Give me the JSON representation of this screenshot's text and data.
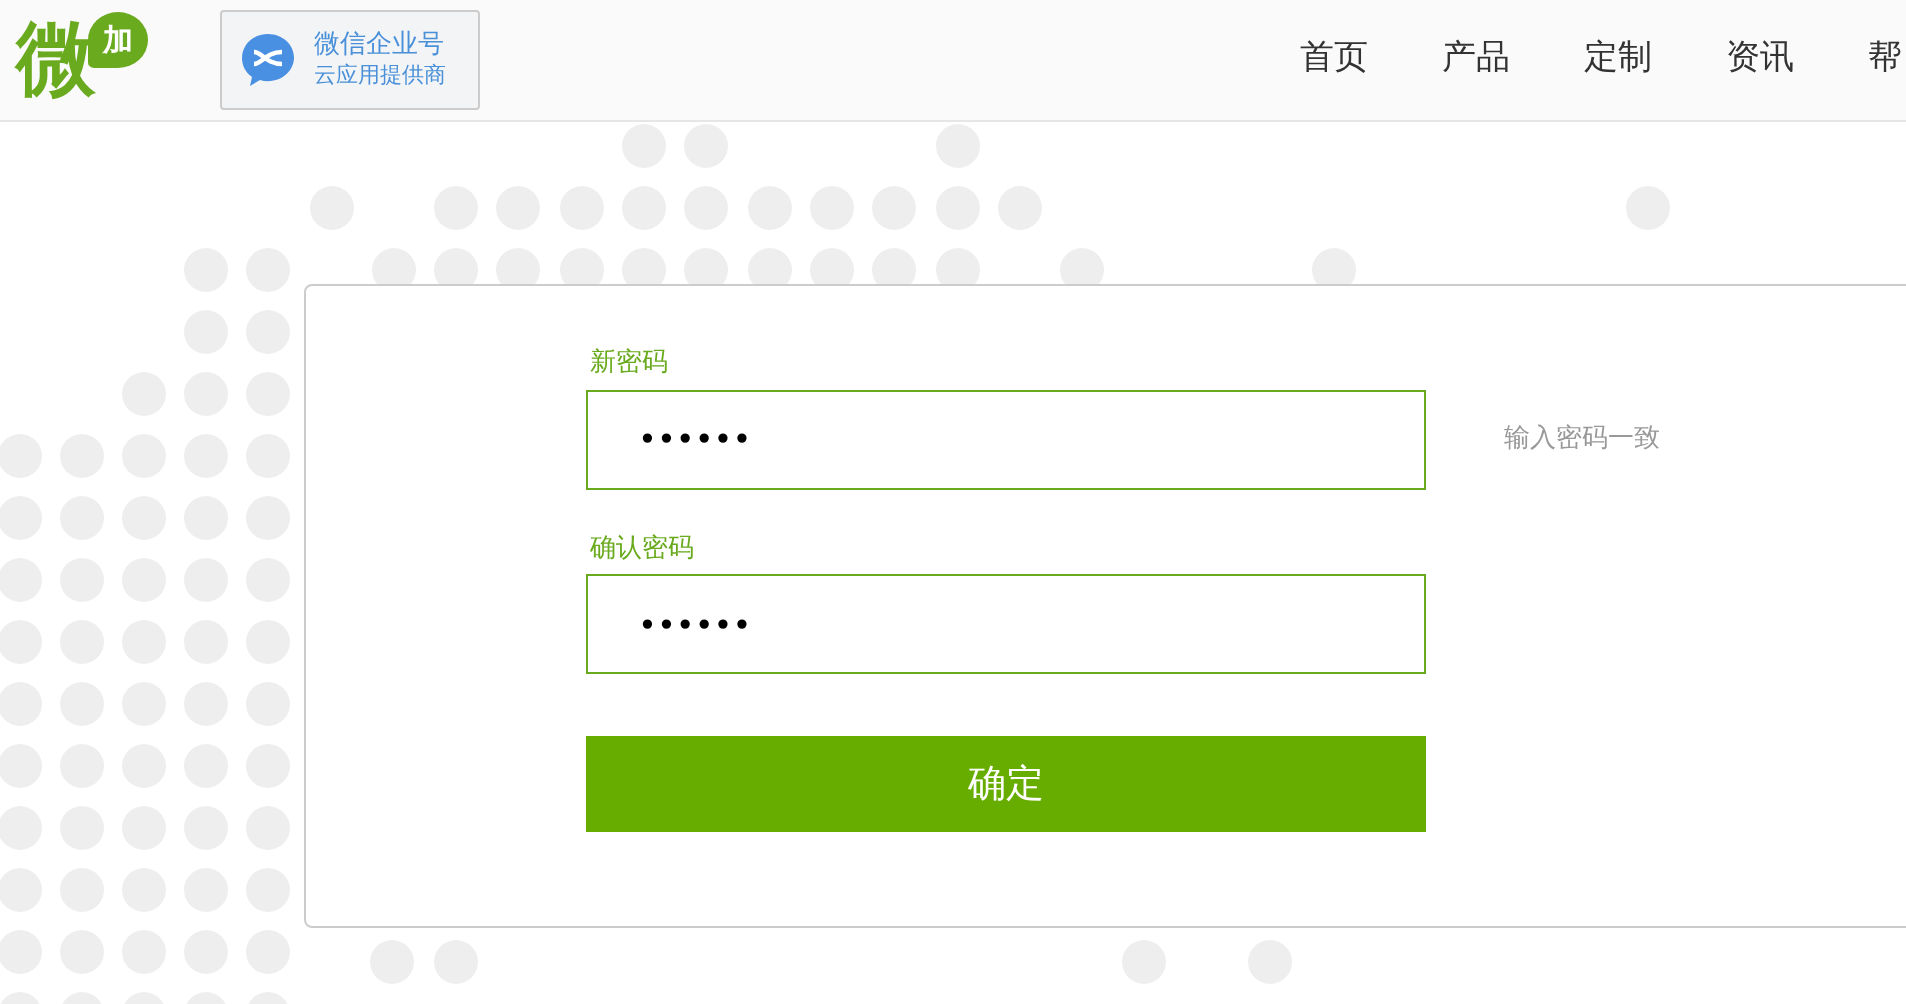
{
  "header": {
    "logo": {
      "main": "微",
      "bubble": "加"
    },
    "partner_badge": {
      "title": "微信企业号",
      "subtitle": "云应用提供商"
    },
    "nav": [
      {
        "label": "首页"
      },
      {
        "label": "产品"
      },
      {
        "label": "定制"
      },
      {
        "label": "资讯"
      },
      {
        "label": "帮"
      }
    ]
  },
  "form": {
    "fields": [
      {
        "label": "新密码",
        "value": "••••••",
        "hint": "输入密码一致"
      },
      {
        "label": "确认密码",
        "value": "••••••"
      }
    ],
    "submit": "确定"
  }
}
